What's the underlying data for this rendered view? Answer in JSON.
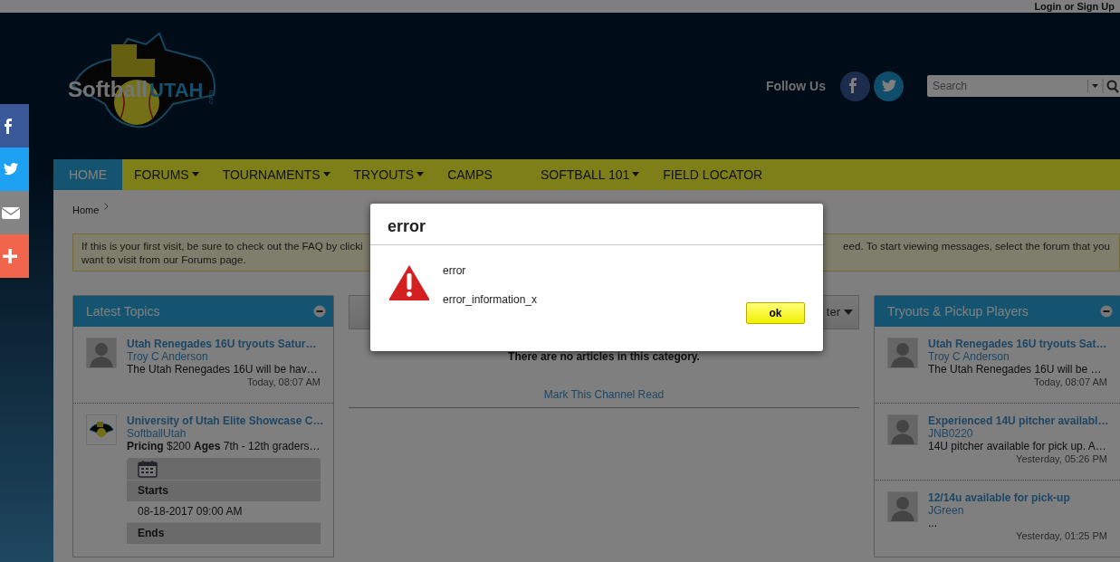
{
  "top_bar": {
    "login_link": "Login or Sign Up"
  },
  "header": {
    "logo": {
      "word_1": "Softball",
      "word_2": "UTAH",
      "suffix": ".com"
    },
    "follow_label": "Follow Us",
    "social": [
      {
        "kind": "facebook"
      },
      {
        "kind": "twitter"
      }
    ],
    "search": {
      "placeholder": "Search"
    }
  },
  "share_bar": [
    {
      "kind": "facebook"
    },
    {
      "kind": "twitter"
    },
    {
      "kind": "email"
    },
    {
      "kind": "plus"
    }
  ],
  "nav": [
    {
      "label": "HOME",
      "selected": true,
      "dropdown": false
    },
    {
      "label": "FORUMS",
      "selected": false,
      "dropdown": true
    },
    {
      "label": "TOURNAMENTS",
      "selected": false,
      "dropdown": true
    },
    {
      "label": "TRYOUTS",
      "selected": false,
      "dropdown": true
    },
    {
      "label": "CAMPS",
      "selected": false,
      "dropdown": false
    },
    {
      "label": "SOFTBALL 101",
      "selected": false,
      "dropdown": true
    },
    {
      "label": "FIELD LOCATOR",
      "selected": false,
      "dropdown": false
    }
  ],
  "breadcrumb": [
    "Home"
  ],
  "notice": {
    "line_1_start": "If this is your first visit, be sure to check out the FAQ by clicki",
    "line_1_end": "eed. To start viewing messages, select the forum that you",
    "line_2": "want to visit from our Forums page."
  },
  "latest_topics": {
    "title": "Latest Topics",
    "items": [
      {
        "kind": "silhouette",
        "title": "Utah Renegades 16U tryouts Satur…",
        "author": "Troy C Anderson",
        "excerpt": "The Utah Renegades 16U will be hav…",
        "time": "Today, 08:07 AM"
      },
      {
        "kind": "logo",
        "title": "University of Utah Elite Showcase C…",
        "author": "SoftballUtah",
        "excerpt": "**Pricing** $200 **Ages** 7th - 12th graders…",
        "event": {
          "starts_label": "Starts",
          "starts_value": "08-18-2017 09:00 AM",
          "ends_label": "Ends"
        }
      }
    ]
  },
  "center": {
    "filter_button": "ter",
    "empty_message": "There are no articles in this category.",
    "mark_read_link": "Mark This Channel Read"
  },
  "tryouts": {
    "title": "Tryouts & Pickup Players",
    "items": [
      {
        "kind": "silhouette",
        "title": "Utah Renegades 16U tryouts Sat…",
        "author": "Troy C Anderson",
        "excerpt": "The Utah Renegades 16U will be …",
        "time": "Today, 08:07 AM"
      },
      {
        "kind": "silhouette",
        "title": "Experienced 14U pitcher availabl…",
        "author": "JNB0220",
        "excerpt": "14U pitcher available for pick up. A…",
        "time": "Yesterday, 05:26 PM"
      },
      {
        "kind": "silhouette",
        "title": "12/14u available for pick-up",
        "author": "JGreen",
        "excerpt": "...",
        "time": "Yesterday, 01:25 PM"
      }
    ]
  },
  "dialog": {
    "title": "error",
    "message": "error",
    "detail": "error_information_x",
    "ok_button": "ok"
  }
}
